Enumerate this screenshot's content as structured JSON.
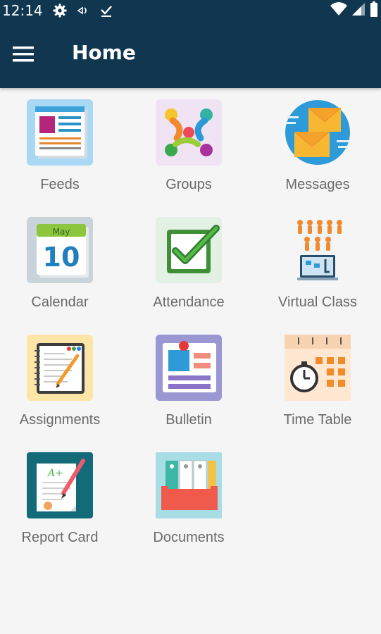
{
  "status_bar": {
    "time": "12:14",
    "icons": [
      "settings-gear-icon",
      "nfc-icon",
      "download-done-icon",
      "wifi-icon",
      "signal-icon",
      "battery-icon"
    ]
  },
  "app_bar": {
    "title": "Home",
    "menu_icon": "hamburger-menu-icon"
  },
  "colors": {
    "header": "#113750",
    "background": "#f5f5f5",
    "label": "#6a6a6a"
  },
  "tiles": [
    {
      "label": "Feeds",
      "icon": "feeds-icon"
    },
    {
      "label": "Groups",
      "icon": "groups-icon"
    },
    {
      "label": "Messages",
      "icon": "messages-icon"
    },
    {
      "label": "Calendar",
      "icon": "calendar-icon",
      "month": "May",
      "day": "10"
    },
    {
      "label": "Attendance",
      "icon": "attendance-icon"
    },
    {
      "label": "Virtual Class",
      "icon": "virtual-class-icon"
    },
    {
      "label": "Assignments",
      "icon": "assignments-icon"
    },
    {
      "label": "Bulletin",
      "icon": "bulletin-icon"
    },
    {
      "label": "Time Table",
      "icon": "time-table-icon"
    },
    {
      "label": "Report Card",
      "icon": "report-card-icon",
      "grade": "A+"
    },
    {
      "label": "Documents",
      "icon": "documents-icon"
    }
  ]
}
